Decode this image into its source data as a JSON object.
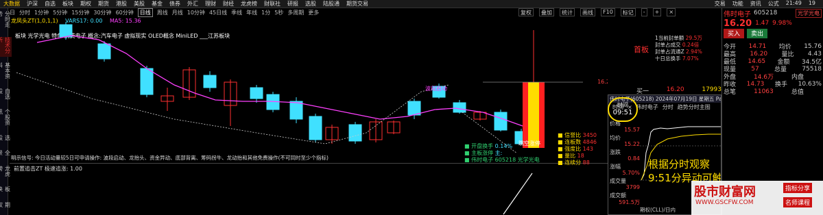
{
  "topbar": {
    "items": [
      "大数据",
      "沪深",
      "自选",
      "板块",
      "期权",
      "期货",
      "港股",
      "美股",
      "基金",
      "债券",
      "外汇",
      "理财",
      "财经",
      "龙虎榜",
      "财联社",
      "研报",
      "选股",
      "陆股通",
      "期货交易"
    ],
    "right": [
      "交易",
      "功能",
      "资讯",
      "公式",
      "21:49",
      "19"
    ]
  },
  "tabbar": {
    "tabs": [
      "日",
      "分时",
      "1分钟",
      "5分钟",
      "15分钟",
      "30分钟",
      "60分钟",
      "日线",
      "周线",
      "月线",
      "10分钟",
      "45日线",
      "季线",
      "年线",
      "1分",
      "5秒",
      "多周期",
      "更多"
    ],
    "selected": 7
  },
  "toolbar": [
    "复权",
    "叠加",
    "统计",
    "画线",
    "F10",
    "标记",
    "-",
    "+",
    "×"
  ],
  "sidebar": [
    "分时走势",
    "技术分析",
    "基本资料",
    "自选股",
    "个股资讯",
    "选股",
    "全景",
    "龙虎榜",
    "板块",
    "期权"
  ],
  "chart": {
    "indicator_line": "龙凤头ZT(1,0,1,1)",
    "ma_line": "MA5: 15.36",
    "extra_line": "VARS17: 0.00",
    "concept_tags": "板块 光学光电   特色   消费电子 概念:汽车电子 虚拟现实 OLED概念 MiniLED ___江苏板块",
    "box_title": "首板",
    "box_items": [
      {
        "label": "1当前封单额",
        "value": "29.5万"
      },
      {
        "label": "封单占成交",
        "value": "0.24倍"
      },
      {
        "label": "封单占流通Z",
        "value": "2.94%"
      },
      {
        "label": "十日总换手",
        "value": "7.07%"
      }
    ],
    "annot_start": "波段启动",
    "annot_breakout": "跳空涨停",
    "annot_price": "16.20",
    "legend_left": [
      {
        "label": "开盘换手",
        "value": "0.14%"
      },
      {
        "label": "主板涨停",
        "value": "主:"
      },
      {
        "label": "伟时电子 605218 光学光电"
      }
    ],
    "legend_right": [
      {
        "label": "信誉比",
        "value": "3450"
      },
      {
        "label": "连板数",
        "value": "4846"
      },
      {
        "label": "强度比",
        "value": "143"
      },
      {
        "label": "量比",
        "value": "18"
      },
      {
        "label": "连续分",
        "value": "88"
      }
    ],
    "note_line": "明示信号: 今日活动量较5日可申请操作: 波段启动、龙抬头、资金异动、底部背离、筹码拐牛、龙动抬和其他免费操作(不可同时至少个指标)",
    "sub_indicator": "前置追击ZT 极速追涨: 1.00"
  },
  "stock": {
    "name": "伟时电子",
    "code": "605218",
    "tag": "光学光电",
    "price": "16.20",
    "change": "1.47",
    "pct": "9.98%",
    "buy_btn": "买入",
    "sell_btn": "卖出",
    "rows": [
      {
        "l1": "今开",
        "v1": "14.71",
        "l2": "均价",
        "v2": "15.76"
      },
      {
        "l1": "最高",
        "v1": "16.20",
        "l2": "量比",
        "v2": "4.43"
      },
      {
        "l1": "最低",
        "v1": "14.65",
        "l2": "金额",
        "v2": "34.5亿"
      },
      {
        "l1": "现量",
        "v1": "57",
        "l2": "总量",
        "v2": "75518"
      },
      {
        "l1": "外盘",
        "v1": "14.6万",
        "l2": "内盘",
        "v2": ""
      },
      {
        "l1": "昨收",
        "v1": "14.73",
        "l2": "换手",
        "v2": "10.63%"
      },
      {
        "l1": "总笔",
        "v1": "11063",
        "l2": "总值",
        "v2": ""
      }
    ],
    "buy1_label": "买一",
    "buy1_price": "16.20",
    "buy1_vol": "17993"
  },
  "popup": {
    "title": "伟时电子(605218) 2024年07月19日 星期五 PageUp/Down:前后日 空格键:操作",
    "tab_labels": [
      "时间",
      "×",
      "伟时电子",
      "分时",
      "趋势分时主图"
    ],
    "time_label": "时间",
    "time_value": "09:51",
    "side": [
      {
        "k": "价格",
        "v": "15.57"
      },
      {
        "k": "均价",
        "v": "15.22"
      },
      {
        "k": "涨跌",
        "v": "0.84"
      },
      {
        "k": "涨幅",
        "v": "5.70%"
      },
      {
        "k": "成交量",
        "v": "3799"
      },
      {
        "k": "成交额",
        "v": "591.5万"
      }
    ],
    "right_ticks": [
      "16.20",
      "10.53%",
      "7.77%",
      "7.02%",
      "5.27%",
      "3.51%",
      "1.76%",
      "0.00%",
      "14.13"
    ],
    "right_ticks_left": [
      "15.43",
      "15.13",
      "14.73"
    ],
    "note_1": "根据分时观察",
    "note_2": "9:51分异动可触发信号",
    "footer": "期权(CLL)/日内"
  },
  "right_side": {
    "times": [
      "14:53",
      "14:53"
    ],
    "vals": [
      "16.20",
      "15.20"
    ],
    "percent": "16.10"
  },
  "watermark": {
    "title": "股市财富网",
    "url": "WWW.GSCFW.COM",
    "tag1": "指标分享",
    "tag2": "名师课程"
  },
  "colors": {
    "up": "#ff3030",
    "down": "#40e0ff",
    "ma": "#ff40ff",
    "highlight": "#ffdd00"
  }
}
